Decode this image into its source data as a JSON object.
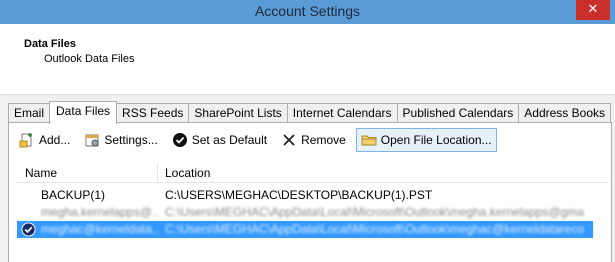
{
  "window": {
    "title": "Account Settings",
    "close_glyph": "✕"
  },
  "header": {
    "title": "Data Files",
    "subtitle": "Outlook Data Files"
  },
  "tabs": [
    {
      "label": "Email",
      "active": false
    },
    {
      "label": "Data Files",
      "active": true
    },
    {
      "label": "RSS Feeds",
      "active": false
    },
    {
      "label": "SharePoint Lists",
      "active": false
    },
    {
      "label": "Internet Calendars",
      "active": false
    },
    {
      "label": "Published Calendars",
      "active": false
    },
    {
      "label": "Address Books",
      "active": false
    }
  ],
  "toolbar": {
    "add": "Add...",
    "settings": "Settings...",
    "set_default": "Set as Default",
    "remove": "Remove",
    "open_location": "Open File Location..."
  },
  "list": {
    "columns": [
      "Name",
      "Location"
    ],
    "rows": [
      {
        "name": "BACKUP(1)",
        "location": "C:\\USERS\\MEGHAC\\DESKTOP\\BACKUP(1).PST",
        "selected": false,
        "default": false
      },
      {
        "name": "megha.kernelapps@...",
        "location": "C:\\Users\\MEGHAC\\AppData\\Local\\Microsoft\\Outlook\\megha.kernelapps@gma...",
        "selected": false,
        "default": false
      },
      {
        "name": "meghac@kerneldata...",
        "location": "C:\\Users\\MEGHAC\\AppData\\Local\\Microsoft\\Outlook\\meghac@kerneldatareco...",
        "selected": true,
        "default": true
      }
    ]
  },
  "colors": {
    "titlebar": "#5b9bd5",
    "close": "#c9302c",
    "selection": "#3399ff"
  }
}
